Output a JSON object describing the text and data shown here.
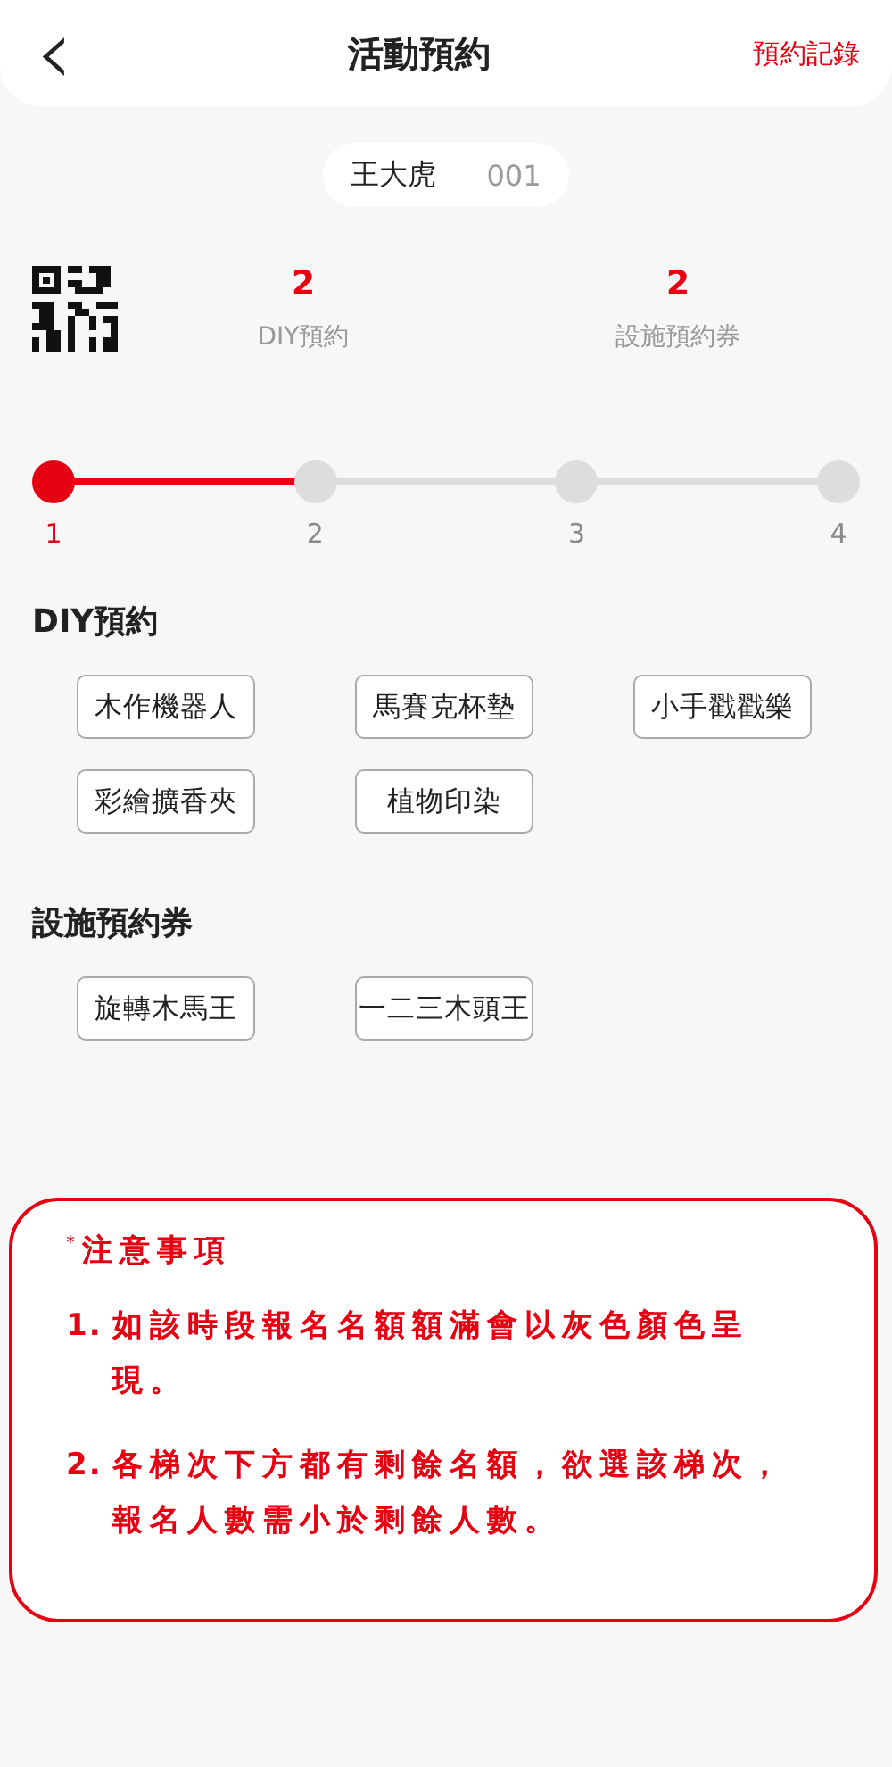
{
  "header": {
    "back_icon": "‹",
    "title": "活動預約",
    "action": "預約記錄"
  },
  "user": {
    "name": "王大虎",
    "number": "001"
  },
  "stats": [
    {
      "value": "2",
      "label": "DIY預約"
    },
    {
      "value": "2",
      "label": "設施預約券"
    }
  ],
  "steps": [
    {
      "label": "1",
      "selected": true
    },
    {
      "label": "2",
      "selected": false
    },
    {
      "label": "3",
      "selected": false
    },
    {
      "label": "4",
      "selected": false
    }
  ],
  "sections": [
    {
      "title": "DIY預約",
      "options": [
        "木作機器人",
        "馬賽克杯墊",
        "小手戳戳樂",
        "彩繪擴香夾",
        "植物印染"
      ]
    },
    {
      "title": "設施預約券",
      "options": [
        "旋轉木馬王",
        "一二三木頭王"
      ]
    }
  ],
  "notes": {
    "title": "$^{*}$注意事項",
    "items": [
      {
        "number": "1.",
        "text": "如該時段報名名額額滿會以灰色顏色呈現。"
      },
      {
        "number": "2.",
        "text": "各梯次下方都有剩餘名額，欲選該梯次，報名人數需小於剩餘人數。"
      }
    ]
  }
}
